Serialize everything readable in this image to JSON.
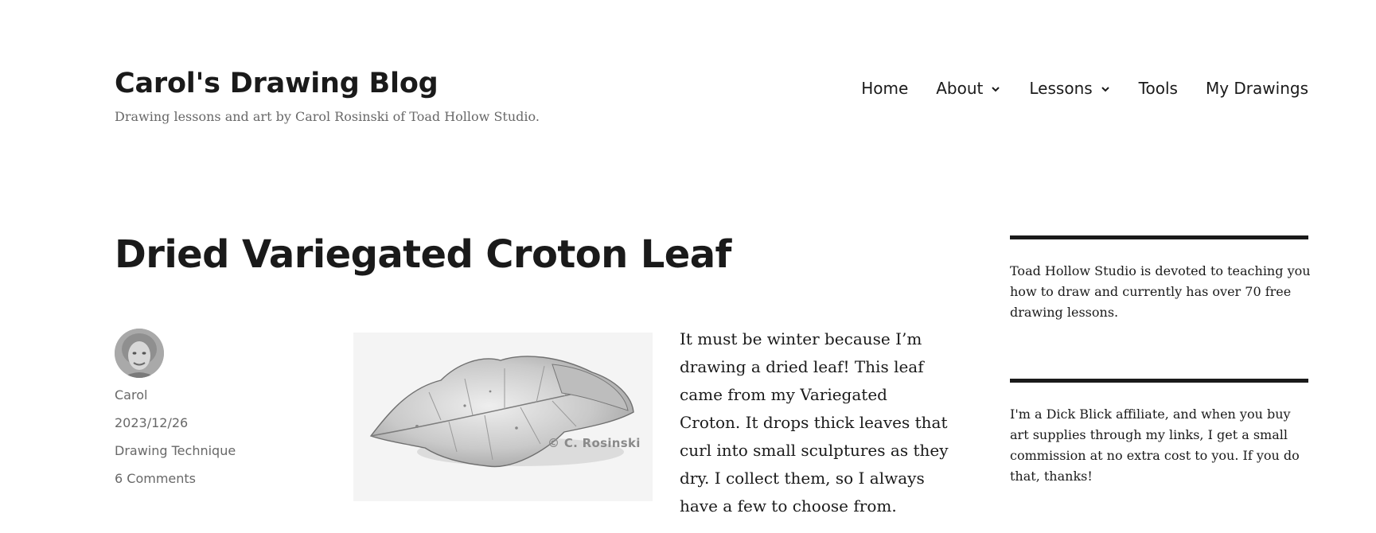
{
  "site": {
    "title": "Carol's Drawing Blog",
    "tagline": "Drawing lessons and art by Carol Rosinski of Toad Hollow Studio."
  },
  "nav": {
    "items": [
      {
        "label": "Home",
        "icon": ""
      },
      {
        "label": "About",
        "icon": "chevron-down-icon"
      },
      {
        "label": "Lessons",
        "icon": "chevron-down-icon"
      },
      {
        "label": "Tools",
        "icon": ""
      },
      {
        "label": "My Drawings",
        "icon": ""
      }
    ]
  },
  "post": {
    "title": "Dried Variegated Croton Leaf",
    "author": "Carol",
    "date": "2023/12/26",
    "category": "Drawing Technique",
    "comments": "6 Comments",
    "image_watermark": "© C. Rosinski",
    "body": "It must be winter because I’m drawing a dried leaf! This leaf came from my Variegated Croton. It drops thick leaves that curl into small sculptures as they dry. I collect them, so I always have a few to choose from."
  },
  "sidebar": {
    "widgets": [
      {
        "text": "Toad Hollow Studio is devoted to teaching you how to draw and currently has over 70 free drawing lessons."
      },
      {
        "text": "I'm a Dick Blick affiliate, and when you buy art supplies through my links, I get a small commission at no extra cost to you. If you do that, thanks!"
      }
    ]
  },
  "colors": {
    "text": "#1a1a1a",
    "muted": "#686868",
    "background": "#ffffff",
    "rule": "#1a1a1a"
  }
}
